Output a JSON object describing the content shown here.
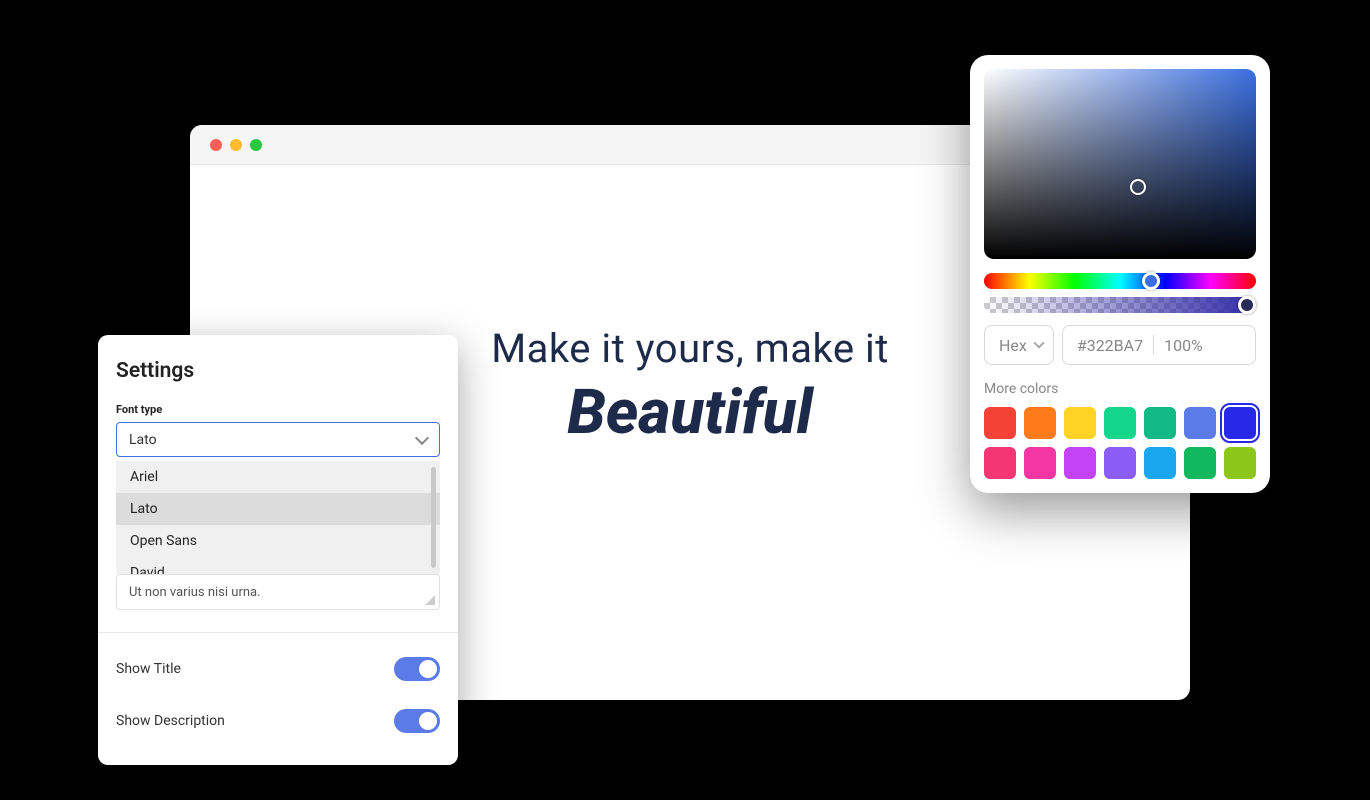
{
  "hero": {
    "line1": "Make it yours, make it",
    "line2": "Beautiful"
  },
  "settings": {
    "title": "Settings",
    "font_type_label": "Font type",
    "font_selected": "Lato",
    "font_options": [
      "Ariel",
      "Lato",
      "Open Sans",
      "David"
    ],
    "textarea_value": "Ut non varius nisi urna.",
    "toggles": {
      "show_title": "Show Title",
      "show_description": "Show Description"
    }
  },
  "picker": {
    "format": "Hex",
    "hex": "#322BA7",
    "opacity": "100%",
    "more_label": "More colors",
    "swatches_row1": [
      "#f44336",
      "#ff7b1a",
      "#ffd226",
      "#13d68a",
      "#12b886",
      "#5b7be8",
      "#2828e8"
    ],
    "swatches_row2": [
      "#f43672",
      "#f436a2",
      "#c244f4",
      "#8b5cf6",
      "#1aa7f0",
      "#12b85e",
      "#8cc61a"
    ],
    "selected_swatch_index": 6
  }
}
